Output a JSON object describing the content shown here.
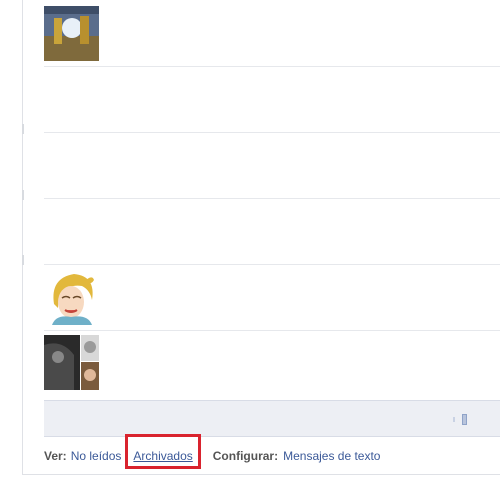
{
  "conversations": [
    {
      "avatar": "avatar-photo-action",
      "has_avatar": true
    },
    {
      "avatar": null,
      "has_avatar": false
    },
    {
      "avatar": null,
      "has_avatar": false
    },
    {
      "avatar": null,
      "has_avatar": false
    },
    {
      "avatar": "avatar-cartoon-blonde",
      "has_avatar": true
    },
    {
      "avatar": "avatar-collage",
      "has_avatar": true
    }
  ],
  "load_more": {
    "icon": "loading-indicator-icon"
  },
  "footer": {
    "view_label": "Ver:",
    "unread_link": "No leídos",
    "archived_link": "Archivados",
    "configure_label": "Configurar:",
    "sms_link": "Mensajes de texto"
  },
  "colors": {
    "link": "#3b5998",
    "highlight": "#d9232e",
    "load_more_bg": "#edeff4"
  }
}
